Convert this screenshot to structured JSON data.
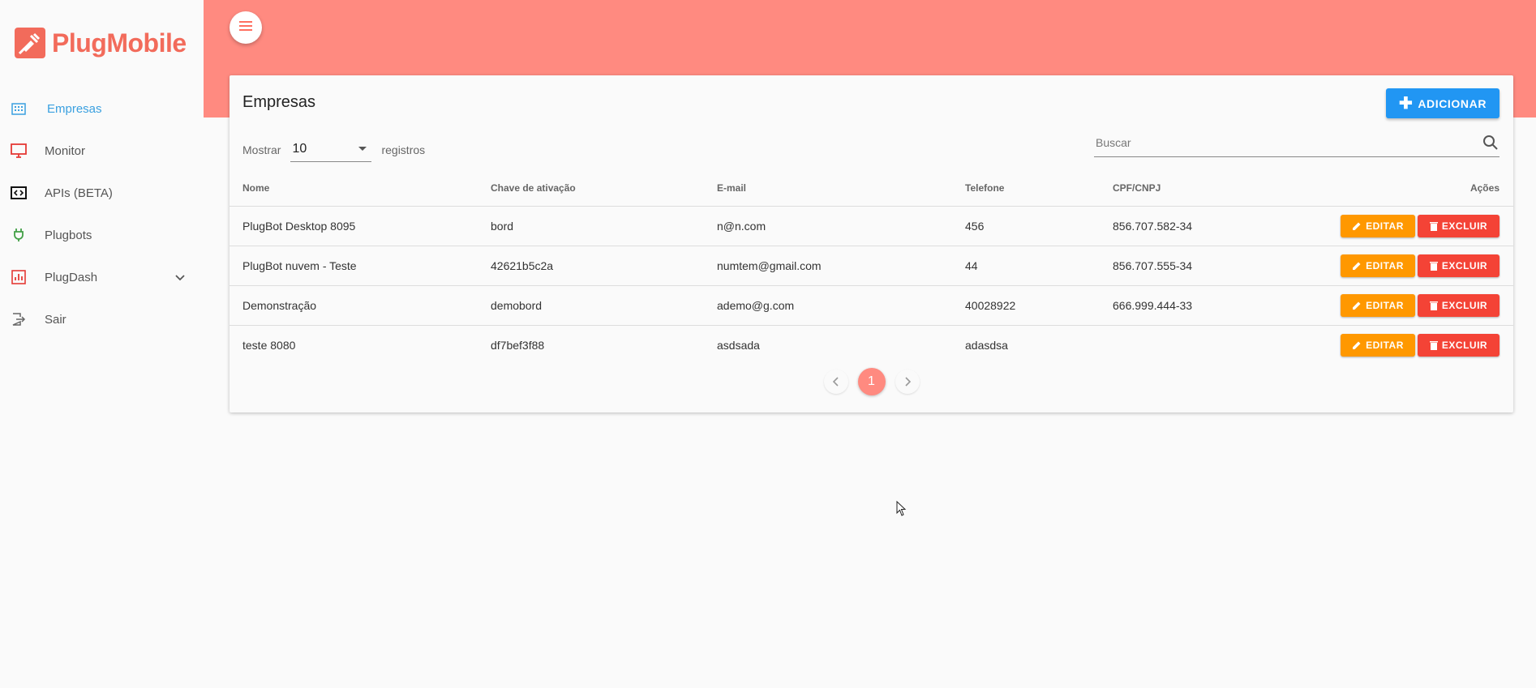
{
  "brand": {
    "name": "PlugMobile",
    "color": "#f26b5b"
  },
  "sidebar": {
    "items": [
      {
        "label": "Empresas",
        "icon": "building-icon",
        "active": true
      },
      {
        "label": "Monitor",
        "icon": "monitor-icon"
      },
      {
        "label": "APIs (BETA)",
        "icon": "code-icon"
      },
      {
        "label": "Plugbots",
        "icon": "plug-icon"
      },
      {
        "label": "PlugDash",
        "icon": "chart-icon",
        "expandable": true
      },
      {
        "label": "Sair",
        "icon": "logout-icon"
      }
    ]
  },
  "header": {
    "menu_icon": "menu-icon",
    "color": "#ff8a80"
  },
  "main": {
    "title": "Empresas",
    "add_label": "ADICIONAR",
    "show_label": "Mostrar",
    "page_size": "10",
    "records_label": "registros",
    "search_placeholder": "Buscar",
    "columns": [
      "Nome",
      "Chave de ativação",
      "E-mail",
      "Telefone",
      "CPF/CNPJ",
      "Ações"
    ],
    "rows": [
      {
        "nome": "PlugBot Desktop 8095",
        "chave": "bord",
        "email": "n@n.com",
        "telefone": "456",
        "cpf": "856.707.582-34"
      },
      {
        "nome": "PlugBot nuvem - Teste",
        "chave": "42621b5c2a",
        "email": "numtem@gmail.com",
        "telefone": "44",
        "cpf": "856.707.555-34"
      },
      {
        "nome": "Demonstração",
        "chave": "demobord",
        "email": "ademo@g.com",
        "telefone": "40028922",
        "cpf": "666.999.444-33"
      },
      {
        "nome": "teste 8080",
        "chave": "df7bef3f88",
        "email": "asdsada",
        "telefone": "adasdsa",
        "cpf": ""
      }
    ],
    "edit_label": "EDITAR",
    "delete_label": "EXCLUIR",
    "current_page": "1"
  },
  "colors": {
    "add": "#2196f3",
    "edit": "#ff9800",
    "delete": "#f44336",
    "active_nav": "#3aa0e0"
  }
}
